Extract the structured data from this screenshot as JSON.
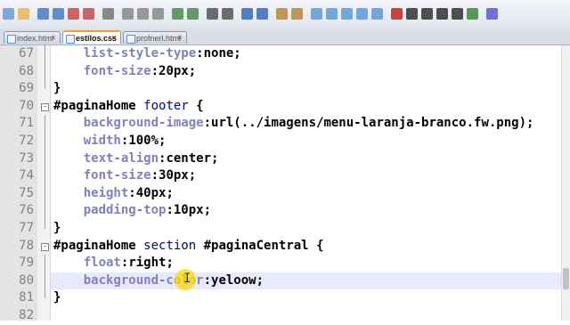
{
  "toolbar": {
    "buttons": [
      "new-file",
      "open-file",
      "save",
      "save-all",
      "close",
      "close-all",
      "print",
      "cut",
      "copy",
      "paste",
      "undo",
      "redo",
      "find",
      "replace",
      "zoom-in",
      "zoom-out",
      "sync-v",
      "sync-h",
      "word-wrap",
      "show-all",
      "indent-guide",
      "doc-map",
      "function-list",
      "record-macro",
      "stop-macro",
      "play-macro",
      "run-macro",
      "save-macro",
      "launch",
      "spell-check"
    ]
  },
  "tabs": [
    {
      "label": "index.html",
      "active": false
    },
    {
      "label": "estilos.css",
      "active": true
    },
    {
      "label": "profnerl.html",
      "active": false
    }
  ],
  "lines": [
    {
      "num": "67",
      "code": "    list-style-type:none;"
    },
    {
      "num": "68",
      "code": "    font-size:20px;"
    },
    {
      "num": "69",
      "code": "}"
    },
    {
      "num": "70",
      "code": "#paginaHome footer {"
    },
    {
      "num": "71",
      "code": "    background-image:url(../imagens/menu-laranja-branco.fw.png);"
    },
    {
      "num": "72",
      "code": "    width:100%;"
    },
    {
      "num": "73",
      "code": "    text-align:center;"
    },
    {
      "num": "74",
      "code": "    font-size:30px;"
    },
    {
      "num": "75",
      "code": "    height:40px;"
    },
    {
      "num": "76",
      "code": "    padding-top:10px;"
    },
    {
      "num": "77",
      "code": "}"
    },
    {
      "num": "78",
      "code": "#paginaHome section #paginaCentral {"
    },
    {
      "num": "79",
      "code": "    float:right;"
    },
    {
      "num": "80",
      "code": "    background-color:yeloow;"
    },
    {
      "num": "81",
      "code": "}"
    },
    {
      "num": "82",
      "code": ""
    }
  ],
  "cursor": {
    "glyph": "I"
  },
  "colors": {
    "property": "#8080c0",
    "value": "#000000",
    "selector": "#000000",
    "tag": "#0000a0",
    "current_line": "#e8e8ff",
    "gutter": "#e4e4e4",
    "active_tab_accent": "#f0a030"
  }
}
